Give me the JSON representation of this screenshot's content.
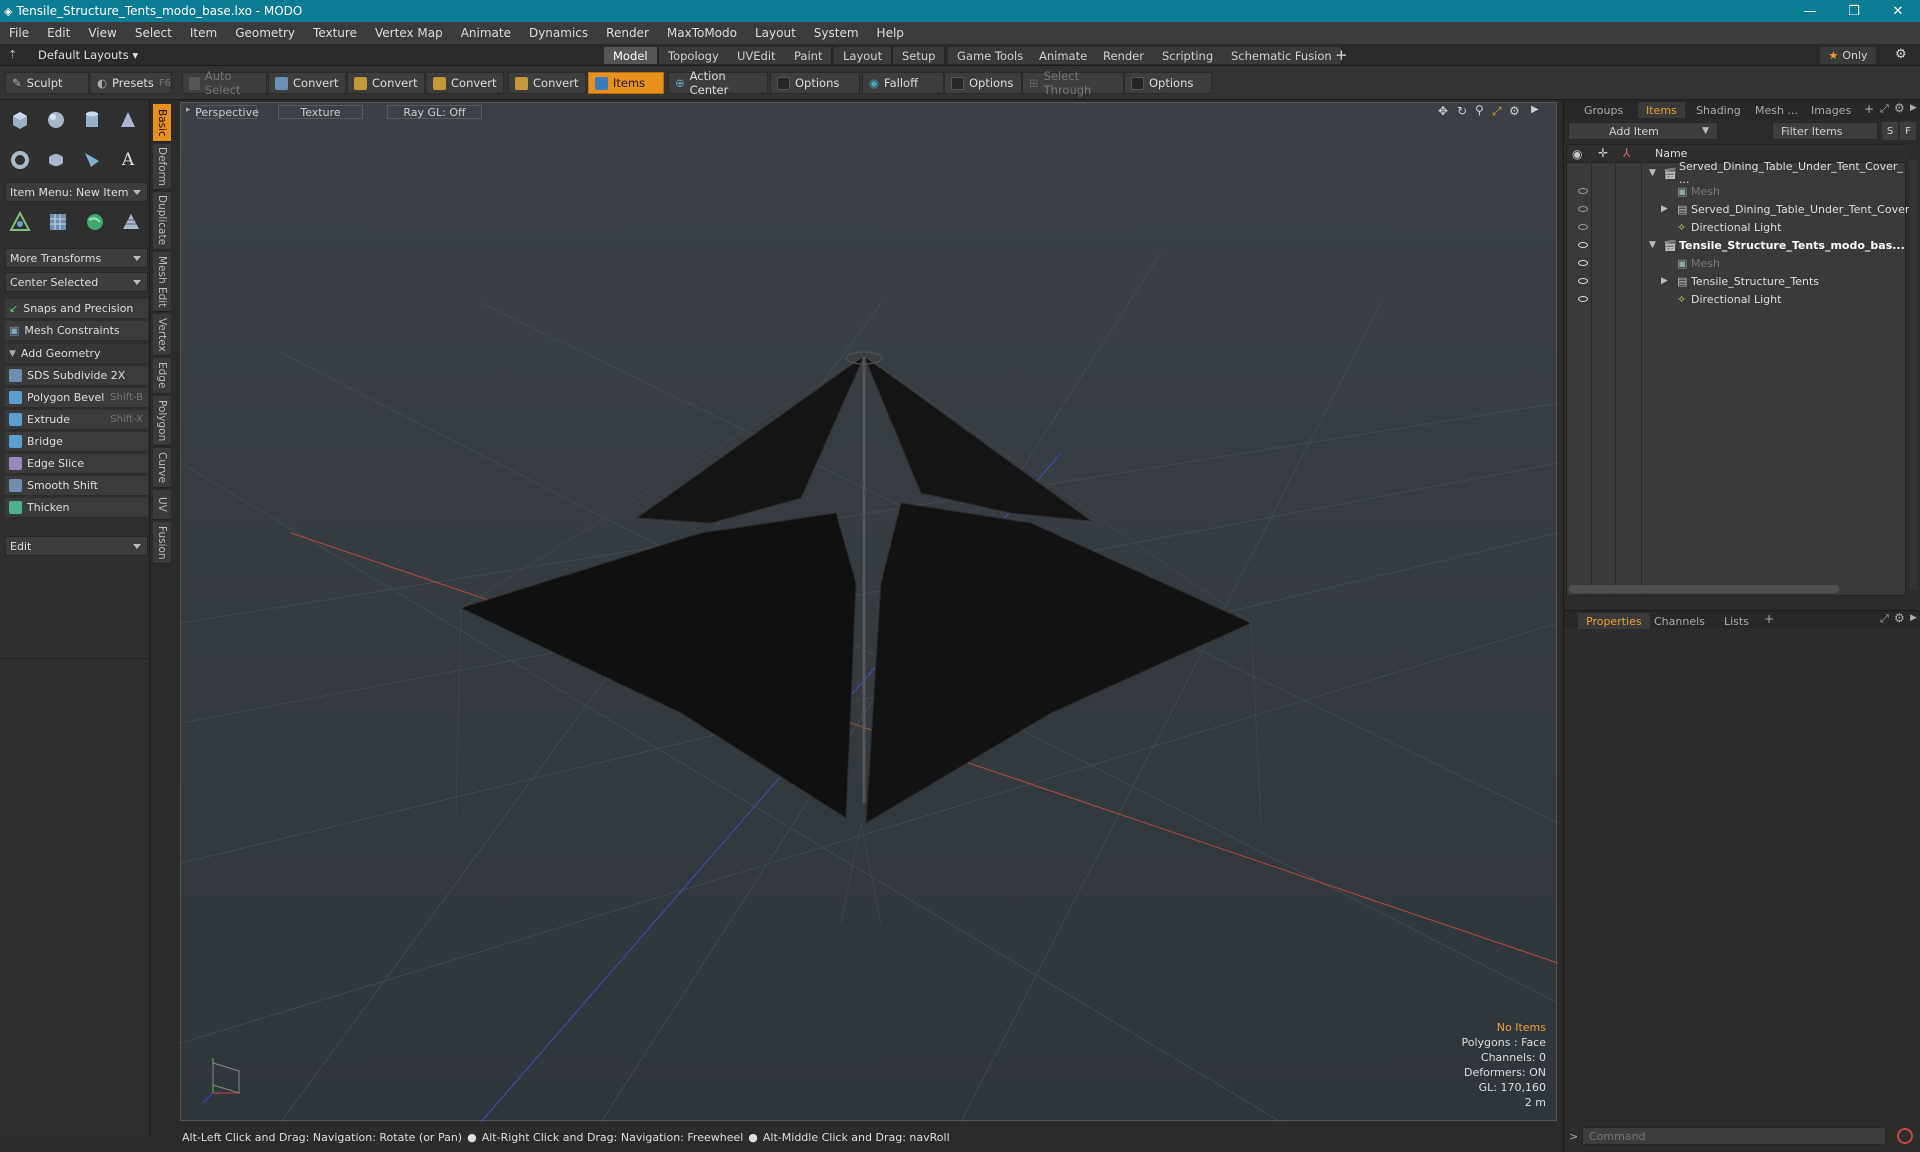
{
  "window": {
    "title": "Tensile_Structure_Tents_modo_base.lxo - MODO",
    "minimize": "—",
    "maximize": "❐",
    "close": "✕"
  },
  "menu": [
    "File",
    "Edit",
    "View",
    "Select",
    "Item",
    "Geometry",
    "Texture",
    "Vertex Map",
    "Animate",
    "Dynamics",
    "Render",
    "MaxToModo",
    "Layout",
    "System",
    "Help"
  ],
  "layouts": {
    "default": "Default Layouts",
    "tabs": [
      "Model",
      "Topology",
      "UVEdit",
      "Paint",
      "Layout",
      "Setup",
      "Game Tools",
      "Animate",
      "Render",
      "Scripting",
      "Schematic Fusion"
    ],
    "add": "+",
    "only": "Only"
  },
  "toolbar": {
    "sculpt": "Sculpt",
    "presets": "Presets",
    "presets_key": "F6",
    "auto_select": "Auto Select",
    "convert1": "Convert",
    "convert2": "Convert",
    "convert3": "Convert",
    "convert4": "Convert",
    "items": "Items",
    "action_center": "Action Center",
    "options1": "Options",
    "falloff": "Falloff",
    "options2": "Options",
    "select_through": "Select Through",
    "options3": "Options"
  },
  "left": {
    "item_menu": "Item Menu: New Item",
    "more_transforms": "More Transforms",
    "center_selected": "Center Selected",
    "snaps": "Snaps and Precision",
    "constraints": "Mesh Constraints",
    "add_geometry": "Add Geometry",
    "tools": [
      {
        "label": "SDS Subdivide 2X",
        "key": ""
      },
      {
        "label": "Polygon Bevel",
        "key": "Shift-B"
      },
      {
        "label": "Extrude",
        "key": "Shift-X"
      },
      {
        "label": "Bridge",
        "key": ""
      },
      {
        "label": "Edge Slice",
        "key": ""
      },
      {
        "label": "Smooth Shift",
        "key": ""
      },
      {
        "label": "Thicken",
        "key": ""
      }
    ],
    "edit": "Edit"
  },
  "vtabs": [
    "Basic",
    "Deform",
    "Duplicate",
    "Mesh Edit",
    "Vertex",
    "Edge",
    "Polygon",
    "Curve",
    "UV",
    "Fusion"
  ],
  "viewport": {
    "view": "Perspective",
    "shading": "Texture",
    "raygl": "Ray GL: Off",
    "info": {
      "items": "No Items",
      "polygons": "Polygons : Face",
      "channels": "Channels: 0",
      "deformers": "Deformers: ON",
      "gl": "GL: 170,160",
      "scale": "2 m"
    }
  },
  "status": {
    "hint1": "Alt-Left Click and Drag: Navigation: Rotate (or Pan)",
    "hint2": "Alt-Right Click and Drag: Navigation: Freewheel",
    "hint3": "Alt-Middle Click and Drag: navRoll"
  },
  "right": {
    "tabs": [
      "Groups",
      "Items",
      "Shading",
      "Mesh ...",
      "Images"
    ],
    "add_item": "Add Item",
    "filter": "Filter Items",
    "s": "S",
    "f": "F",
    "col_name": "Name",
    "tree": [
      {
        "label": "Served_Dining_Table_Under_Tent_Cover_ ...",
        "bold": false,
        "dim": false
      },
      {
        "label": "Mesh",
        "bold": false,
        "dim": true
      },
      {
        "label": "Served_Dining_Table_Under_Tent_Cover",
        "bold": false,
        "dim": false
      },
      {
        "label": "Directional Light",
        "bold": false,
        "dim": false
      },
      {
        "label": "Tensile_Structure_Tents_modo_bas...",
        "bold": true,
        "dim": false
      },
      {
        "label": "Mesh",
        "bold": false,
        "dim": true
      },
      {
        "label": "Tensile_Structure_Tents",
        "bold": false,
        "dim": false
      },
      {
        "label": "Directional Light",
        "bold": false,
        "dim": false
      }
    ],
    "prop_tabs": [
      "Properties",
      "Channels",
      "Lists"
    ],
    "command_placeholder": "Command"
  },
  "colors": {
    "accent": "#e8901c",
    "title": "#0c7b94"
  }
}
